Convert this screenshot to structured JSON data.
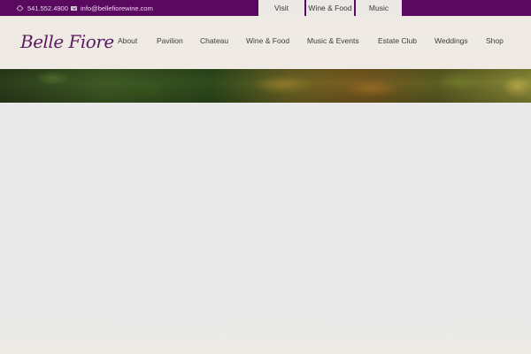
{
  "topbar": {
    "phone": "541.552.4900",
    "email": "info@bellefiorewine.com",
    "tabs": [
      "Visit",
      "Wine & Food",
      "Music"
    ],
    "colors": {
      "bar": "#5a0a5e",
      "tab": "#ece8e3"
    }
  },
  "header": {
    "logo": "Belle Fiore",
    "nav": [
      "About",
      "Pavilion",
      "Chateau",
      "Wine & Food",
      "Music & Events",
      "Estate Club",
      "Weddings",
      "Shop"
    ]
  }
}
